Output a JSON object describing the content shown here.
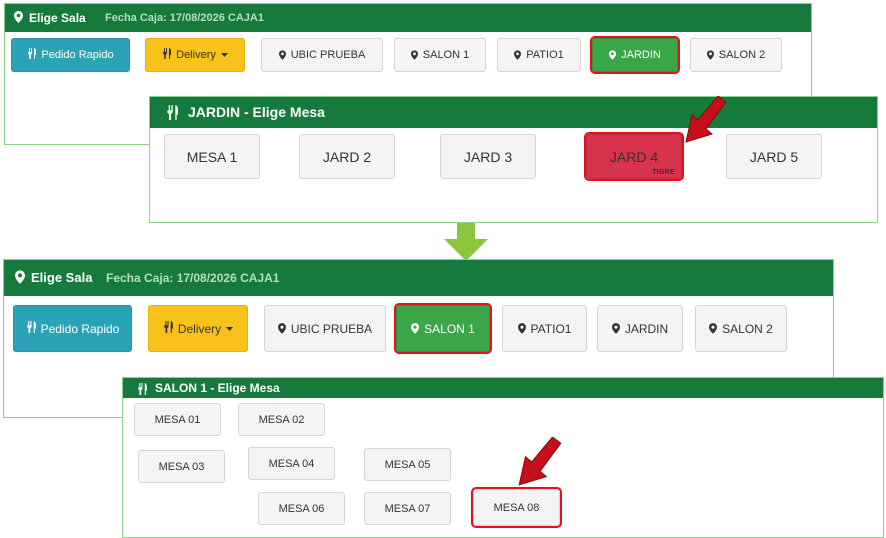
{
  "top": {
    "header": {
      "title": "Elige Sala",
      "fecha": "Fecha Caja: 17/08/2026 CAJA1"
    },
    "buttons": {
      "pedido": "Pedido Rapido",
      "delivery": "Delivery",
      "sala1": "UBIC PRUEBA",
      "sala2": "SALON 1",
      "sala3": "PATIO1",
      "sala4": "JARDIN",
      "sala5": "SALON 2"
    }
  },
  "jardin_panel": {
    "title": "JARDIN - Elige Mesa",
    "tables": [
      "MESA 1",
      "JARD 2",
      "JARD 3",
      "JARD 4",
      "JARD 5"
    ],
    "badge": "TIGRE"
  },
  "bottom": {
    "header": {
      "title": "Elige Sala",
      "fecha": "Fecha Caja: 17/08/2026 CAJA1"
    },
    "buttons": {
      "pedido": "Pedido Rapido",
      "delivery": "Delivery",
      "sala1": "UBIC PRUEBA",
      "sala2": "SALON 1",
      "sala3": "PATIO1",
      "sala4": "JARDIN",
      "sala5": "SALON 2"
    }
  },
  "salon_panel": {
    "title": "SALON 1 - Elige Mesa",
    "tables": [
      "MESA 01",
      "MESA 02",
      "MESA 03",
      "MESA 04",
      "MESA 05",
      "MESA 06",
      "MESA 07",
      "MESA 08"
    ]
  },
  "colors": {
    "header_green": "#157a3b",
    "teal": "#2aa3b6",
    "yellow": "#f9c11c",
    "selected_green": "#3aa648",
    "occupied_red": "#d7334c",
    "highlight_red": "#e3101d",
    "arrow_green": "#8cc63f"
  }
}
